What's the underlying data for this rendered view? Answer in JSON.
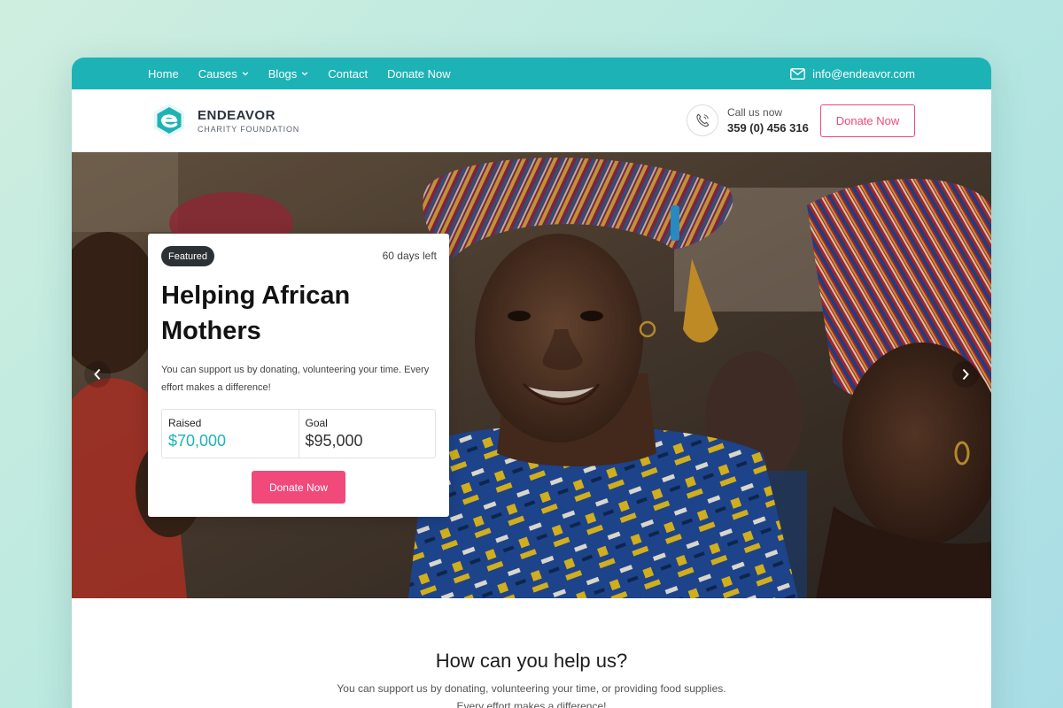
{
  "topbar": {
    "nav": [
      {
        "label": "Home",
        "has_dropdown": false
      },
      {
        "label": "Causes",
        "has_dropdown": true
      },
      {
        "label": "Blogs",
        "has_dropdown": true
      },
      {
        "label": "Contact",
        "has_dropdown": false
      },
      {
        "label": "Donate Now",
        "has_dropdown": false
      }
    ],
    "email": "info@endeavor.com",
    "email_icon": "mail-icon"
  },
  "header": {
    "brand_name": "ENDEAVOR",
    "brand_sub": "CHARITY FOUNDATION",
    "call_label": "Call us now",
    "call_number": "359 (0) 456 316",
    "phone_icon": "phone-icon",
    "donate_label": "Donate Now"
  },
  "hero": {
    "prev_icon": "chevron-left-icon",
    "next_icon": "chevron-right-icon",
    "card": {
      "badge": "Featured",
      "days_left": "60 days left",
      "title": "Helping African Mothers",
      "description": "You can support us by donating, volunteering your time. Every effort makes a difference!",
      "raised_label": "Raised",
      "raised_value": "$70,000",
      "goal_label": "Goal",
      "goal_value": "$95,000",
      "donate_label": "Donate Now"
    }
  },
  "help": {
    "title": "How can you help us?",
    "text_line1": "You can support us by donating, volunteering your time, or providing food supplies.",
    "text_line2": "Every effort makes a difference!"
  },
  "colors": {
    "teal": "#1db3b6",
    "pink": "#f0497a",
    "dark": "#2c3136"
  }
}
